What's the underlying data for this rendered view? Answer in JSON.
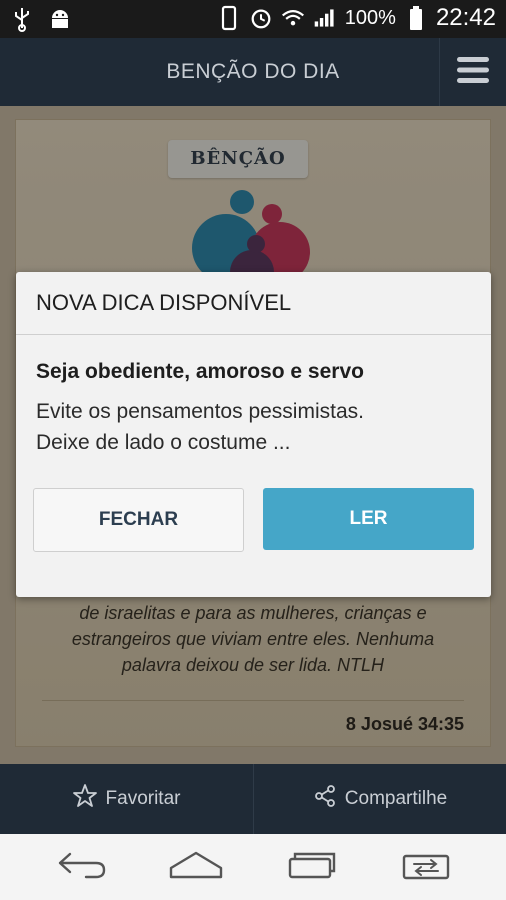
{
  "status_bar": {
    "battery_percent": "100%",
    "time": "22:42",
    "icons": [
      "usb-icon",
      "android-icon",
      "vibrate-icon",
      "alarm-icon",
      "wifi-icon",
      "signal-icon",
      "battery-icon"
    ]
  },
  "app_bar": {
    "title": "BENÇÃO DO DIA",
    "menu_icon": "hamburger-menu-icon"
  },
  "card": {
    "ribbon_label": "BÊNÇÃO",
    "verse_lines": [
      "de israelitas e para as mulheres, crianças e",
      "estrangeiros que viviam entre eles. Nenhuma",
      "palavra deixou de ser lida. NTLH"
    ],
    "reference": "8 Josué  34:35"
  },
  "dialog": {
    "title": "NOVA DICA DISPONÍVEL",
    "heading": "Seja obediente, amoroso e servo",
    "body_lines": [
      "Evite os pensamentos pessimistas.",
      "Deixe de lado o costume ..."
    ],
    "close_label": "FECHAR",
    "read_label": "LER"
  },
  "bottom_bar": {
    "favorite_label": "Favoritar",
    "share_label": "Compartilhe"
  },
  "nav_bar": {
    "icons": [
      "back-icon",
      "home-icon",
      "recent-apps-icon",
      "switch-apps-icon"
    ]
  },
  "colors": {
    "app_bar": "#1f2a36",
    "accent_button": "#45a6c8",
    "card_background": "#d8cbb1",
    "logo_blue": "#2f86a8",
    "logo_red": "#c2385a",
    "logo_purple": "#5b3a5e"
  }
}
